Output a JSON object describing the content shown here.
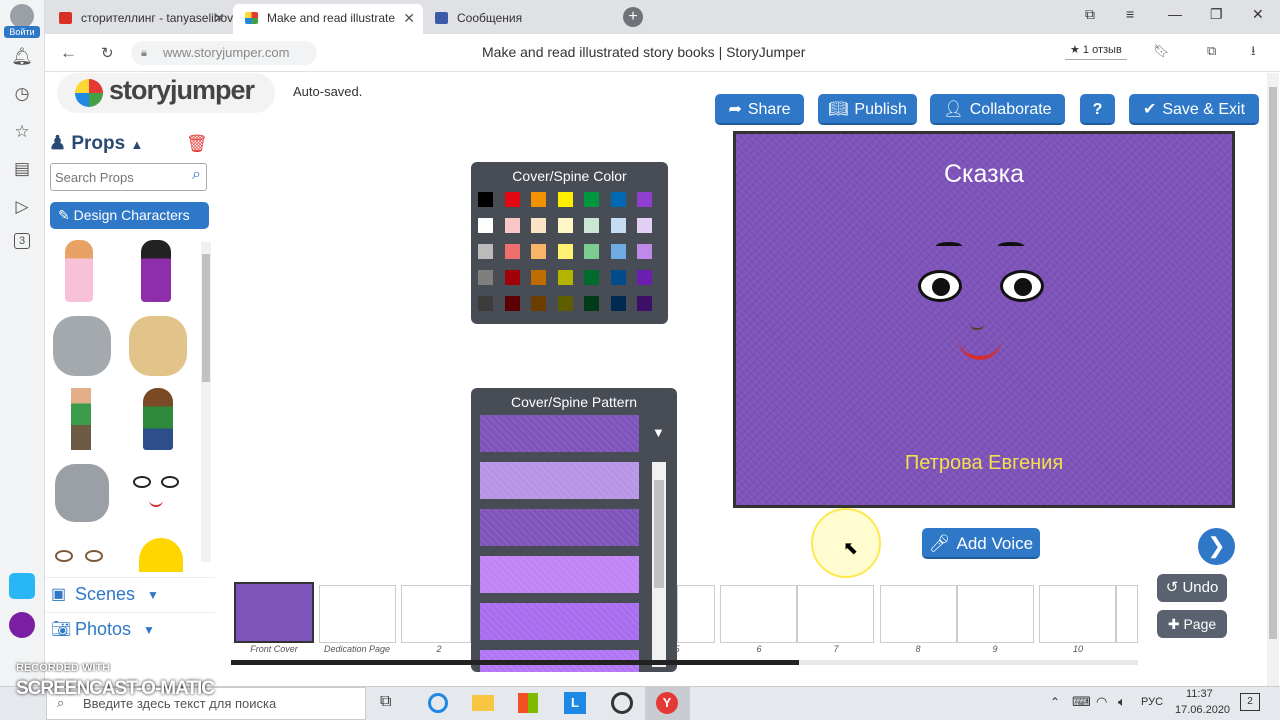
{
  "browser": {
    "tabs": [
      {
        "label": "сторителлинг - tanyaselihov",
        "color": "#d93025"
      },
      {
        "label": "Make and read illustrate",
        "color": "#f4b400"
      },
      {
        "label": "Сообщения",
        "color": "#3b5ba9"
      }
    ],
    "login_label": "Войти",
    "rail_badge": "3",
    "url": "www.storyjumper.com",
    "page_title": "Make and read illustrated story books | StoryJumper",
    "reviews": "★ 1 отзыв"
  },
  "app": {
    "logo": "storyjumper",
    "autosave": "Auto-saved.",
    "toolbar": {
      "share": "Share",
      "publish": "Publish",
      "collaborate": "Collaborate",
      "help": "?",
      "save_exit": "Save & Exit"
    },
    "sidebar": {
      "props_label": "Props",
      "search_placeholder": "Search Props",
      "design_characters": "Design Characters",
      "scenes": "Scenes",
      "photos": "Photos"
    },
    "color_panel": {
      "title": "Cover/Spine Color",
      "colors": [
        [
          "#000000",
          "#e30613",
          "#f39200",
          "#ffed00",
          "#009640",
          "#0069b4",
          "#8f3ecf"
        ],
        [
          "#ffffff",
          "#f8c8c6",
          "#fde3c6",
          "#fff8c6",
          "#c9e7d3",
          "#c6dcf2",
          "#e3cff4"
        ],
        [
          "#bbbbbb",
          "#ef6f6f",
          "#f8b56a",
          "#fff171",
          "#7ccc92",
          "#6fabe3",
          "#bd8ae8"
        ],
        [
          "#7f7f7f",
          "#a0000a",
          "#c06d00",
          "#b3b300",
          "#006b2d",
          "#004c8a",
          "#6a1fb0"
        ],
        [
          "#3c3c3c",
          "#5c0006",
          "#6b3d00",
          "#5e5e00",
          "#003a18",
          "#002a4f",
          "#3d0f66"
        ]
      ]
    },
    "pattern_panel": {
      "title": "Cover/Spine Pattern",
      "patterns": [
        "#7e53ba",
        "#b794e6",
        "#7e53ba",
        "#c084f5",
        "#a86cee",
        "#b076f5"
      ]
    },
    "cover": {
      "title": "Сказка",
      "author": "Петрова Евгения"
    },
    "add_voice": "Add Voice",
    "undo": "Undo",
    "page": "Page",
    "thumbnails": [
      {
        "label": "Front Cover"
      },
      {
        "label": "Dedication Page"
      },
      {
        "label": "2"
      },
      {
        "label": "5"
      },
      {
        "label": "6"
      },
      {
        "label": "7"
      },
      {
        "label": "8"
      },
      {
        "label": "9"
      },
      {
        "label": "10"
      }
    ]
  },
  "taskbar": {
    "search_placeholder": "Введите здесь текст для поиска",
    "lang": "РУС",
    "time": "11:37",
    "date": "17.06.2020",
    "notifications": "2"
  },
  "watermark": {
    "top": "RECORDED WITH",
    "bottom": "SCREENCAST-O-MATIC"
  }
}
